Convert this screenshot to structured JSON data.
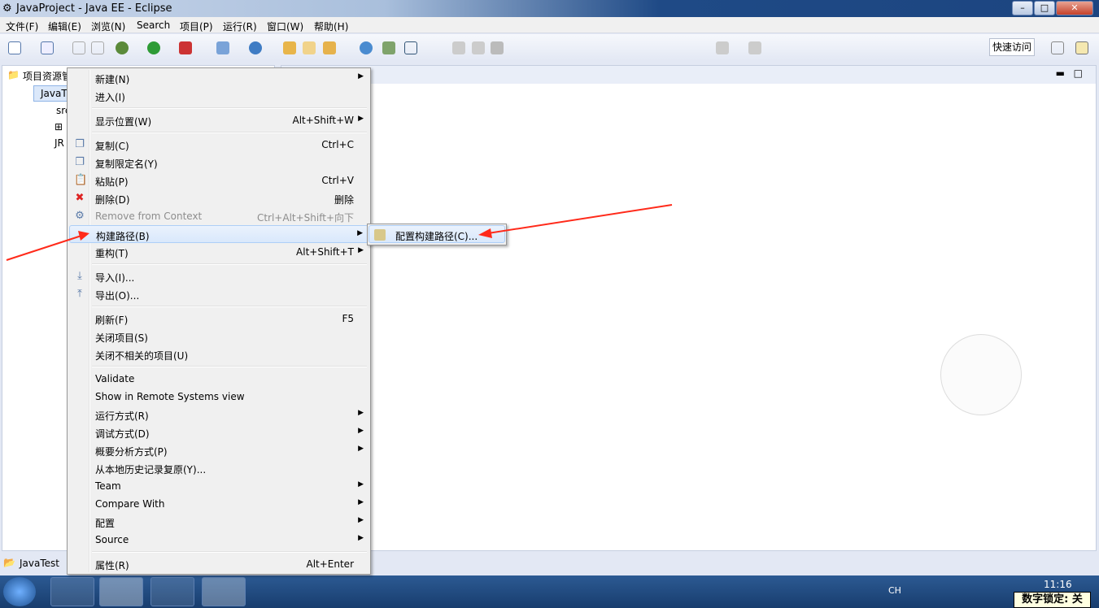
{
  "window": {
    "title": "JavaProject  -  Java EE  -  Eclipse",
    "min": "–",
    "max": "□",
    "close": "✕"
  },
  "menubar": [
    "文件(F)",
    "编辑(E)",
    "浏览(N)",
    "Search",
    "项目(P)",
    "运行(R)",
    "窗口(W)",
    "帮助(H)"
  ],
  "toolbar": {
    "quick_access": "快速访问"
  },
  "explorer": {
    "title": "项目资源管",
    "tree": [
      {
        "label": "JavaT"
      },
      {
        "label": "src"
      },
      {
        "label": "JR"
      }
    ]
  },
  "context_menu": [
    {
      "label": "新建(N)",
      "submenu": true
    },
    {
      "label": "进入(I)"
    },
    {
      "sep": true
    },
    {
      "label": "显示位置(W)",
      "accel": "Alt+Shift+W",
      "submenu": true
    },
    {
      "sep": true
    },
    {
      "label": "复制(C)",
      "accel": "Ctrl+C",
      "icon": "copy-icon"
    },
    {
      "label": "复制限定名(Y)",
      "icon": "copy-qualified-icon"
    },
    {
      "label": "粘贴(P)",
      "accel": "Ctrl+V",
      "icon": "paste-icon"
    },
    {
      "label": "删除(D)",
      "accel": "删除",
      "icon": "delete-icon"
    },
    {
      "label": "Remove from Context",
      "accel": "Ctrl+Alt+Shift+向下",
      "disabled": true,
      "icon": "remove-context-icon"
    },
    {
      "label": "构建路径(B)",
      "submenu": true,
      "highlight": true
    },
    {
      "label": "重构(T)",
      "accel": "Alt+Shift+T",
      "submenu": true
    },
    {
      "sep": true
    },
    {
      "label": "导入(I)...",
      "icon": "import-icon"
    },
    {
      "label": "导出(O)...",
      "icon": "export-icon"
    },
    {
      "sep": true
    },
    {
      "label": "刷新(F)",
      "accel": "F5"
    },
    {
      "label": "关闭项目(S)"
    },
    {
      "label": "关闭不相关的项目(U)"
    },
    {
      "sep": true
    },
    {
      "label": "Validate"
    },
    {
      "label": "Show in Remote Systems view"
    },
    {
      "label": "运行方式(R)",
      "submenu": true
    },
    {
      "label": "调试方式(D)",
      "submenu": true
    },
    {
      "label": "概要分析方式(P)",
      "submenu": true
    },
    {
      "label": "从本地历史记录复原(Y)..."
    },
    {
      "label": "Team",
      "submenu": true
    },
    {
      "label": "Compare With",
      "submenu": true
    },
    {
      "label": "配置",
      "submenu": true
    },
    {
      "label": "Source",
      "submenu": true
    },
    {
      "sep": true
    },
    {
      "label": "属性(R)",
      "accel": "Alt+Enter"
    }
  ],
  "submenu": {
    "label": "配置构建路径(C)..."
  },
  "statusbar": {
    "project": "JavaTest"
  },
  "taskbar": {
    "time": "11:16",
    "lang": "CH",
    "numlock": "数字锁定: 关"
  },
  "colors": {
    "arrow": "#ff2a1a",
    "highlight": "#d9e8fb"
  }
}
